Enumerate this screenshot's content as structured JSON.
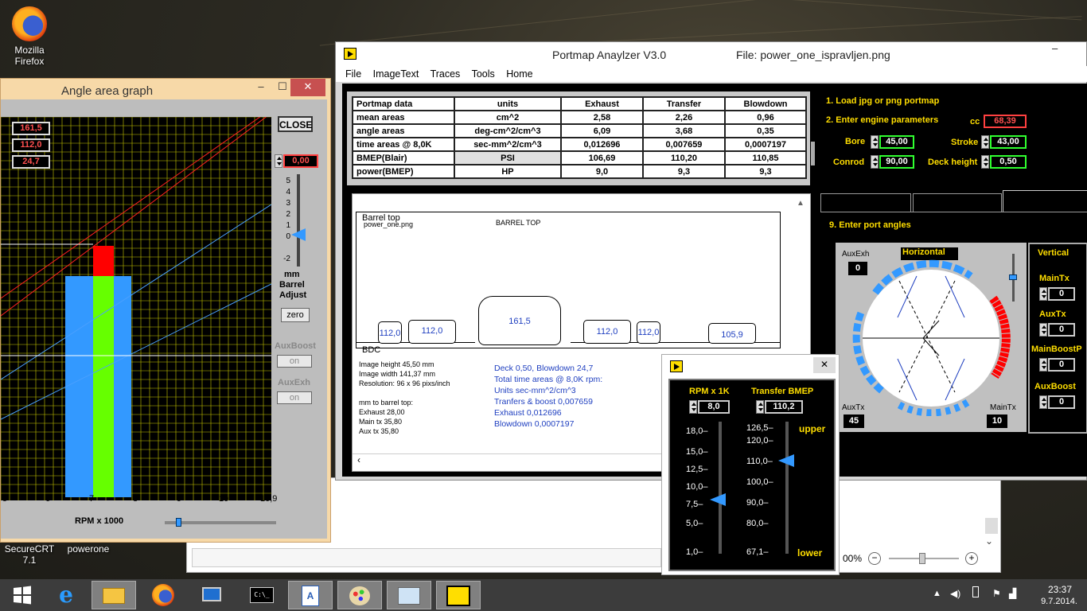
{
  "desktop": {
    "icons": [
      {
        "label_line1": "Mozilla",
        "label_line2": "Firefox"
      },
      {
        "label_line1": "SecureCRT",
        "label_line2": "7.1"
      },
      {
        "label_line1": "powerone",
        "label_line2": ""
      }
    ]
  },
  "angle_window": {
    "title": "Angle area graph",
    "close_label": "CLOSE",
    "values": [
      "161,5",
      "112,0",
      "24,7"
    ],
    "adjust_value": "0,00",
    "scale": [
      "5",
      "4",
      "3",
      "2",
      "1",
      "0",
      "-2"
    ],
    "adjust_label1": "mm",
    "adjust_label2": "Barrel",
    "adjust_label3": "Adjust",
    "zero_label": "zero",
    "auxboost_label": "AuxBoost",
    "auxexh_label": "AuxExh",
    "on_label": "on",
    "x_ticks": [
      "5",
      "6",
      "7",
      "8",
      "9",
      "10",
      "10,9"
    ],
    "x_label": "RPM x 1000",
    "bar_colors": {
      "red": "#ff0000",
      "blue": "#3399ff",
      "green": "#66ff00",
      "grid": "#c8c800"
    }
  },
  "main_window": {
    "title": "Portmap Anaylzer V3.0",
    "file_title": "File: power_one_ispravljen.png",
    "menu": [
      "File",
      "ImageText",
      "Traces",
      "Tools",
      "Home"
    ],
    "table": {
      "headers": [
        "Portmap data",
        "units",
        "Exhaust",
        "Transfer",
        "Blowdown"
      ],
      "rows": [
        [
          "mean areas",
          "cm^2",
          "2,58",
          "2,26",
          "0,96"
        ],
        [
          "angle areas",
          "deg-cm^2/cm^3",
          "6,09",
          "3,68",
          "0,35"
        ],
        [
          "time areas @ 8,0K",
          "sec-mm^2/cm^3",
          "0,012696",
          "0,007659",
          "0,0007197"
        ],
        [
          "BMEP(Blair)",
          "PSI",
          "106,69",
          "110,20",
          "110,85"
        ],
        [
          "power(BMEP)",
          "HP",
          "9,0",
          "9,3",
          "9,3"
        ]
      ]
    },
    "steps": {
      "load": "1. Load jpg or png portmap",
      "engine": "2. Enter engine parameters",
      "cc_label": "cc",
      "cc_value": "68,39",
      "bore_label": "Bore",
      "bore_value": "45,00",
      "stroke_label": "Stroke",
      "stroke_value": "43,00",
      "conrod_label": "Conrod",
      "conrod_value": "90,00",
      "deck_label": "Deck height",
      "deck_value": "0,50",
      "port_angles": "9. Enter port angles"
    },
    "port_angles": {
      "auxexh_label": "AuxExh",
      "auxexh_value": "0",
      "horizontal_label": "Horizontal",
      "auxtx_label": "AuxTx",
      "auxtx_value": "45",
      "maintx_label": "MainTx",
      "maintx_value": "10",
      "vertical_label": "Vertical",
      "v_maintx_label": "MainTx",
      "v_maintx_value": "0",
      "v_auxtx_label": "AuxTx",
      "v_auxtx_value": "0",
      "v_mainboost_label": "MainBoostP",
      "v_mainboost_value": "0",
      "v_auxboost_label": "AuxBoost",
      "v_auxboost_value": "0"
    },
    "image": {
      "barrel_top": "Barrel top",
      "filename": "power_one.png",
      "barrel_top_caps": "BARREL TOP",
      "bdc": "BDC",
      "ports": [
        "112,0",
        "112,0",
        "161,5",
        "112,0",
        "112,0",
        "105,9"
      ],
      "left_info": [
        "Image height  45,50 mm",
        "Image width  141,37 mm",
        "Resolution: 96 x 96 pixs/inch",
        "",
        "mm to barrel top:",
        "Exhaust  28,00",
        "Main tx   35,80",
        "Aux tx    35,80"
      ],
      "right_info": [
        "Deck 0,50,  Blowdown 24,7",
        "Total time areas @ 8,0K rpm:",
        "Units  sec-mm^2/cm^3",
        "Tranfers & boost  0,007659",
        "Exhaust  0,012696",
        "Blowdown  0,0007197"
      ]
    },
    "zoom_label": "00%"
  },
  "rpm_window": {
    "rpm_label": "RPM x 1K",
    "rpm_value": "8,0",
    "bmep_label": "Transfer BMEP",
    "bmep_value": "110,2",
    "rpm_ticks": [
      "18,0",
      "15,0",
      "12,5",
      "10,0",
      "7,5",
      "5,0",
      "1,0"
    ],
    "bmep_ticks": [
      "126,5",
      "120,0",
      "110,0",
      "100,0",
      "90,0",
      "80,0",
      "67,1"
    ],
    "upper_label": "upper",
    "lower_label": "lower"
  },
  "taskbar": {
    "time": "23:37",
    "date": "9.7.2014."
  }
}
